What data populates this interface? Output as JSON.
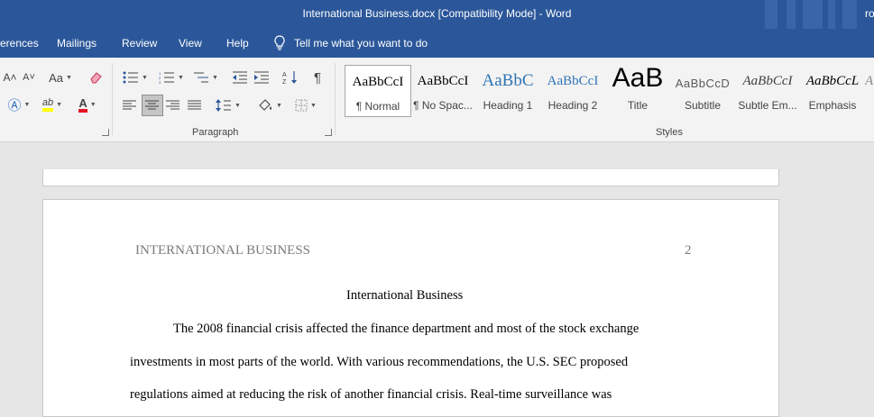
{
  "window": {
    "title": "International Business.docx  [Compatibility Mode]  -  Word",
    "user": "ro"
  },
  "tabs": {
    "references": "erences",
    "mailings": "Mailings",
    "review": "Review",
    "view": "View",
    "help": "Help",
    "tell": "Tell me what you want to do"
  },
  "ribbon": {
    "font": {
      "grow": "A˄",
      "shrink": "A˅",
      "case": "Aa",
      "highlight": "ab",
      "color": "A"
    },
    "paragraph": {
      "label": "Paragraph",
      "pilcrow": "¶"
    },
    "styles": {
      "label": "Styles",
      "items": [
        {
          "preview": "AaBbCcI",
          "name": "¶ Normal"
        },
        {
          "preview": "AaBbCcI",
          "name": "¶ No Spac..."
        },
        {
          "preview": "AaBbC",
          "name": "Heading 1"
        },
        {
          "preview": "AaBbCcI",
          "name": "Heading 2"
        },
        {
          "preview": "AaB",
          "name": "Title"
        },
        {
          "preview": "AaBbCcD",
          "name": "Subtitle"
        },
        {
          "preview": "AaBbCcI",
          "name": "Subtle Em..."
        },
        {
          "preview": "AaBbCcL",
          "name": "Emphasis"
        }
      ]
    }
  },
  "document": {
    "header_left": "INTERNATIONAL BUSINESS",
    "page_number": "2",
    "title": "International Business",
    "lines": [
      "The 2008 financial crisis affected the finance department and most of the stock exchange",
      "investments in most parts of the world. With various recommendations, the U.S. SEC proposed",
      "regulations aimed at reducing the risk of another financial crisis. Real-time surveillance was"
    ]
  },
  "colors": {
    "brand": "#2b579a",
    "highlight": "#ffff00",
    "font_color": "#e81123"
  }
}
